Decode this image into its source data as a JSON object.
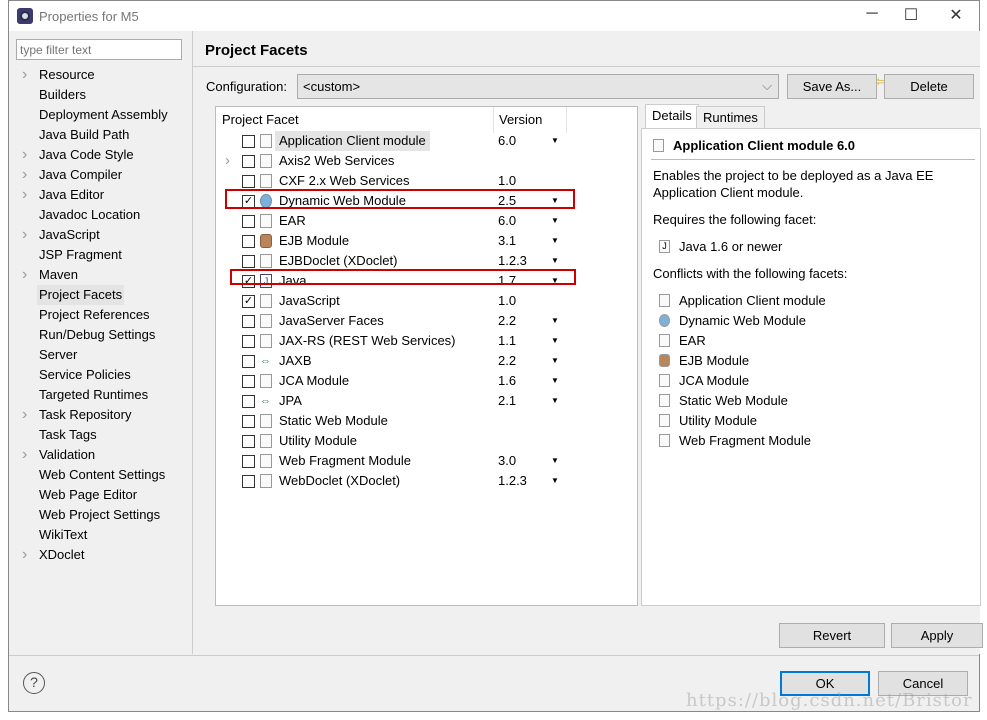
{
  "window": {
    "title": "Properties for M5",
    "minimize": "─",
    "maximize": "☐",
    "close": "✕"
  },
  "filter": {
    "placeholder": "type filter text"
  },
  "sidebar": {
    "items": [
      {
        "label": "Resource",
        "expandable": true
      },
      {
        "label": "Builders"
      },
      {
        "label": "Deployment Assembly"
      },
      {
        "label": "Java Build Path"
      },
      {
        "label": "Java Code Style",
        "expandable": true
      },
      {
        "label": "Java Compiler",
        "expandable": true
      },
      {
        "label": "Java Editor",
        "expandable": true
      },
      {
        "label": "Javadoc Location"
      },
      {
        "label": "JavaScript",
        "expandable": true
      },
      {
        "label": "JSP Fragment"
      },
      {
        "label": "Maven",
        "expandable": true
      },
      {
        "label": "Project Facets",
        "selected": true
      },
      {
        "label": "Project References"
      },
      {
        "label": "Run/Debug Settings"
      },
      {
        "label": "Server"
      },
      {
        "label": "Service Policies"
      },
      {
        "label": "Targeted Runtimes"
      },
      {
        "label": "Task Repository",
        "expandable": true
      },
      {
        "label": "Task Tags"
      },
      {
        "label": "Validation",
        "expandable": true
      },
      {
        "label": "Web Content Settings"
      },
      {
        "label": "Web Page Editor"
      },
      {
        "label": "Web Project Settings"
      },
      {
        "label": "WikiText"
      },
      {
        "label": "XDoclet",
        "expandable": true
      }
    ]
  },
  "page": {
    "title": "Project Facets",
    "config_label": "Configuration:",
    "config_value": "<custom>",
    "save_as": "Save As...",
    "delete": "Delete"
  },
  "table": {
    "col_facet": "Project Facet",
    "col_version": "Version",
    "rows": [
      {
        "name": "Application Client module",
        "version": "6.0",
        "checked": false,
        "dropdown": true,
        "icon": "doc",
        "highlight": true
      },
      {
        "name": "Axis2 Web Services",
        "version": "",
        "checked": false,
        "icon": "doc",
        "expandable": true
      },
      {
        "name": "CXF 2.x Web Services",
        "version": "1.0",
        "checked": false,
        "icon": "doc"
      },
      {
        "name": "Dynamic Web Module",
        "version": "2.5",
        "checked": true,
        "dropdown": true,
        "icon": "web",
        "marked": true
      },
      {
        "name": "EAR",
        "version": "6.0",
        "checked": false,
        "dropdown": true,
        "icon": "doc"
      },
      {
        "name": "EJB Module",
        "version": "3.1",
        "checked": false,
        "dropdown": true,
        "icon": "ejb"
      },
      {
        "name": "EJBDoclet (XDoclet)",
        "version": "1.2.3",
        "checked": false,
        "dropdown": true,
        "icon": "doc"
      },
      {
        "name": "Java",
        "version": "1.7",
        "checked": true,
        "dropdown": true,
        "icon": "java",
        "marked": true
      },
      {
        "name": "JavaScript",
        "version": "1.0",
        "checked": true,
        "icon": "doc"
      },
      {
        "name": "JavaServer Faces",
        "version": "2.2",
        "checked": false,
        "dropdown": true,
        "icon": "doc"
      },
      {
        "name": "JAX-RS (REST Web Services)",
        "version": "1.1",
        "checked": false,
        "dropdown": true,
        "icon": "doc"
      },
      {
        "name": "JAXB",
        "version": "2.2",
        "checked": false,
        "dropdown": true,
        "icon": "jaxb"
      },
      {
        "name": "JCA Module",
        "version": "1.6",
        "checked": false,
        "dropdown": true,
        "icon": "doc"
      },
      {
        "name": "JPA",
        "version": "2.1",
        "checked": false,
        "dropdown": true,
        "icon": "jaxb"
      },
      {
        "name": "Static Web Module",
        "version": "",
        "checked": false,
        "icon": "doc"
      },
      {
        "name": "Utility Module",
        "version": "",
        "checked": false,
        "icon": "doc"
      },
      {
        "name": "Web Fragment Module",
        "version": "3.0",
        "checked": false,
        "dropdown": true,
        "icon": "doc"
      },
      {
        "name": "WebDoclet (XDoclet)",
        "version": "1.2.3",
        "checked": false,
        "dropdown": true,
        "icon": "doc"
      }
    ]
  },
  "details": {
    "tab_details": "Details",
    "tab_runtimes": "Runtimes",
    "heading": "Application Client module 6.0",
    "description": "Enables the project to be deployed as a Java EE",
    "description2": "Application Client module.",
    "requires_label": "Requires the following facet:",
    "requires": [
      {
        "name": "Java 1.6 or newer",
        "icon": "java"
      }
    ],
    "conflicts_label": "Conflicts with the following facets:",
    "conflicts": [
      {
        "name": "Application Client module",
        "icon": "doc"
      },
      {
        "name": "Dynamic Web Module",
        "icon": "web"
      },
      {
        "name": "EAR",
        "icon": "doc"
      },
      {
        "name": "EJB Module",
        "icon": "ejb"
      },
      {
        "name": "JCA Module",
        "icon": "doc"
      },
      {
        "name": "Static Web Module",
        "icon": "doc"
      },
      {
        "name": "Utility Module",
        "icon": "doc"
      },
      {
        "name": "Web Fragment Module",
        "icon": "doc"
      }
    ]
  },
  "buttons": {
    "revert": "Revert",
    "apply": "Apply",
    "ok": "OK",
    "cancel": "Cancel",
    "help": "?"
  },
  "watermark": "https://blog.csdn.net/Bristor",
  "colors": {
    "marker": "#cc0000",
    "ok_border": "#0078d7"
  }
}
